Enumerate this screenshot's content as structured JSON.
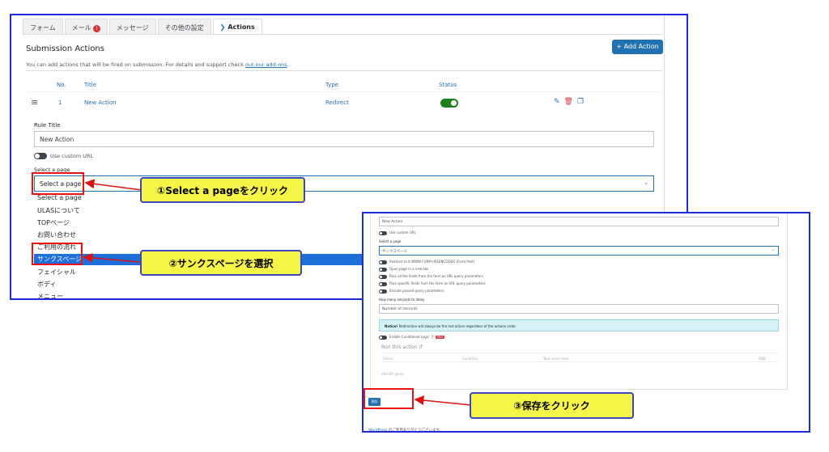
{
  "screen1": {
    "tabs": [
      {
        "label": "フォーム",
        "badge": ""
      },
      {
        "label": "メール",
        "badge": "!"
      },
      {
        "label": "メッセージ",
        "badge": ""
      },
      {
        "label": "その他の設定",
        "badge": ""
      },
      {
        "label": "Actions",
        "badge": ""
      }
    ],
    "section_title": "Submission Actions",
    "add_action_label": "+ Add Action",
    "description": "You can add actions that will be fired on submission. For details and support check ",
    "description_link": "out our add-ons",
    "description_end": ".",
    "table": {
      "headers": {
        "no": "No.",
        "title": "Title",
        "type": "Type",
        "status": "Status"
      },
      "row": {
        "no": "1",
        "title": "New Action",
        "type": "Redirect",
        "status_on": true
      }
    },
    "rule_title_label": "Rule Title",
    "rule_title_value": "New Action",
    "use_custom_url": "Use custom URL",
    "select_page_label": "Select a page",
    "select_value": "Select a page",
    "dropdown_options": [
      "Select a page",
      "ULASについて",
      "TOPページ",
      "お問い合わせ",
      "ご利用の流れ",
      "サンクスページ",
      "フェイシャル",
      "ボディ",
      "メニュー"
    ],
    "highlighted_option": "サンクスページ"
  },
  "screen2": {
    "title_value": "New Action",
    "use_custom_url": "Use custom URL",
    "select_page_label": "Select a page",
    "select_value": "サンクスページ",
    "toggles": [
      "Redirect to it WWW FORM URLENCODED (Form Post)",
      "Open page in a new tab",
      "Pass all the fields from the form as URL query parameters",
      "Pass specific fields from the form as URL query parameters",
      "Encode passed query parameters"
    ],
    "delay_label": "How many seconds to delay",
    "delay_placeholder": "Number of seconds",
    "notice_bold": "Notice!",
    "notice_text": " Redirection will always be the last action regardless of the actions order.",
    "conditional_logic": "Enable Conditional Logic",
    "pro_badge": "PRO",
    "run_title": "Run this action if",
    "cond_fields": [
      "Select",
      "Condition",
      "Your value here",
      "AND"
    ],
    "add_group": "Add OR group",
    "save_label": "保存",
    "footer_link": "WordPress",
    "footer_text": " のご利用ありがとうございます。"
  },
  "callouts": {
    "step1": "①Select a pageをクリック",
    "step2": "②サンクスページを選択",
    "step3": "③保存をクリック"
  },
  "colors": {
    "annotation_border": "#1f2bd6",
    "callout_fill": "#f5f547",
    "arrow_red": "#e11111",
    "wp_blue": "#2271b1"
  }
}
